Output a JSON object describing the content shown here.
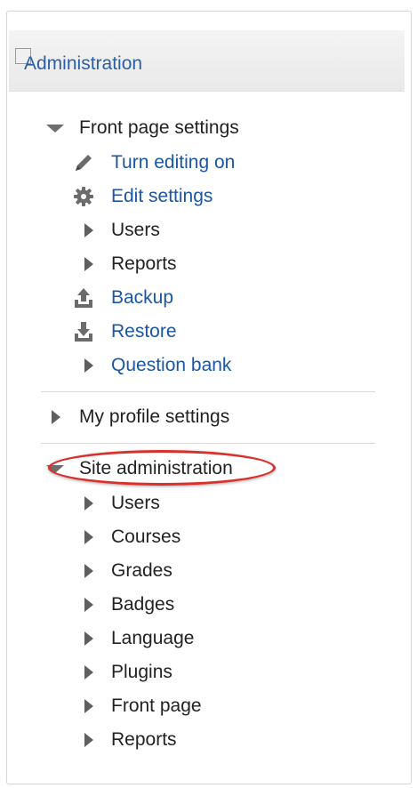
{
  "header": {
    "title": "Administration"
  },
  "front_page": {
    "title": "Front page settings",
    "items": [
      {
        "label": "Turn editing on",
        "icon": "pencil-icon",
        "link": true
      },
      {
        "label": "Edit settings",
        "icon": "gear-icon",
        "link": true
      },
      {
        "label": "Users",
        "icon": "triangle-right-icon",
        "link": false
      },
      {
        "label": "Reports",
        "icon": "triangle-right-icon",
        "link": false
      },
      {
        "label": "Backup",
        "icon": "upload-icon",
        "link": true
      },
      {
        "label": "Restore",
        "icon": "download-icon",
        "link": true
      },
      {
        "label": "Question bank",
        "icon": "triangle-right-icon",
        "link": true
      }
    ]
  },
  "my_profile": {
    "title": "My profile settings"
  },
  "site_admin": {
    "title": "Site administration",
    "items": [
      {
        "label": "Users"
      },
      {
        "label": "Courses"
      },
      {
        "label": "Grades"
      },
      {
        "label": "Badges"
      },
      {
        "label": "Language"
      },
      {
        "label": "Plugins"
      },
      {
        "label": "Front page"
      },
      {
        "label": "Reports"
      }
    ]
  },
  "colors": {
    "link": "#1b56a5",
    "highlight": "#d9302c",
    "text": "#222222"
  }
}
